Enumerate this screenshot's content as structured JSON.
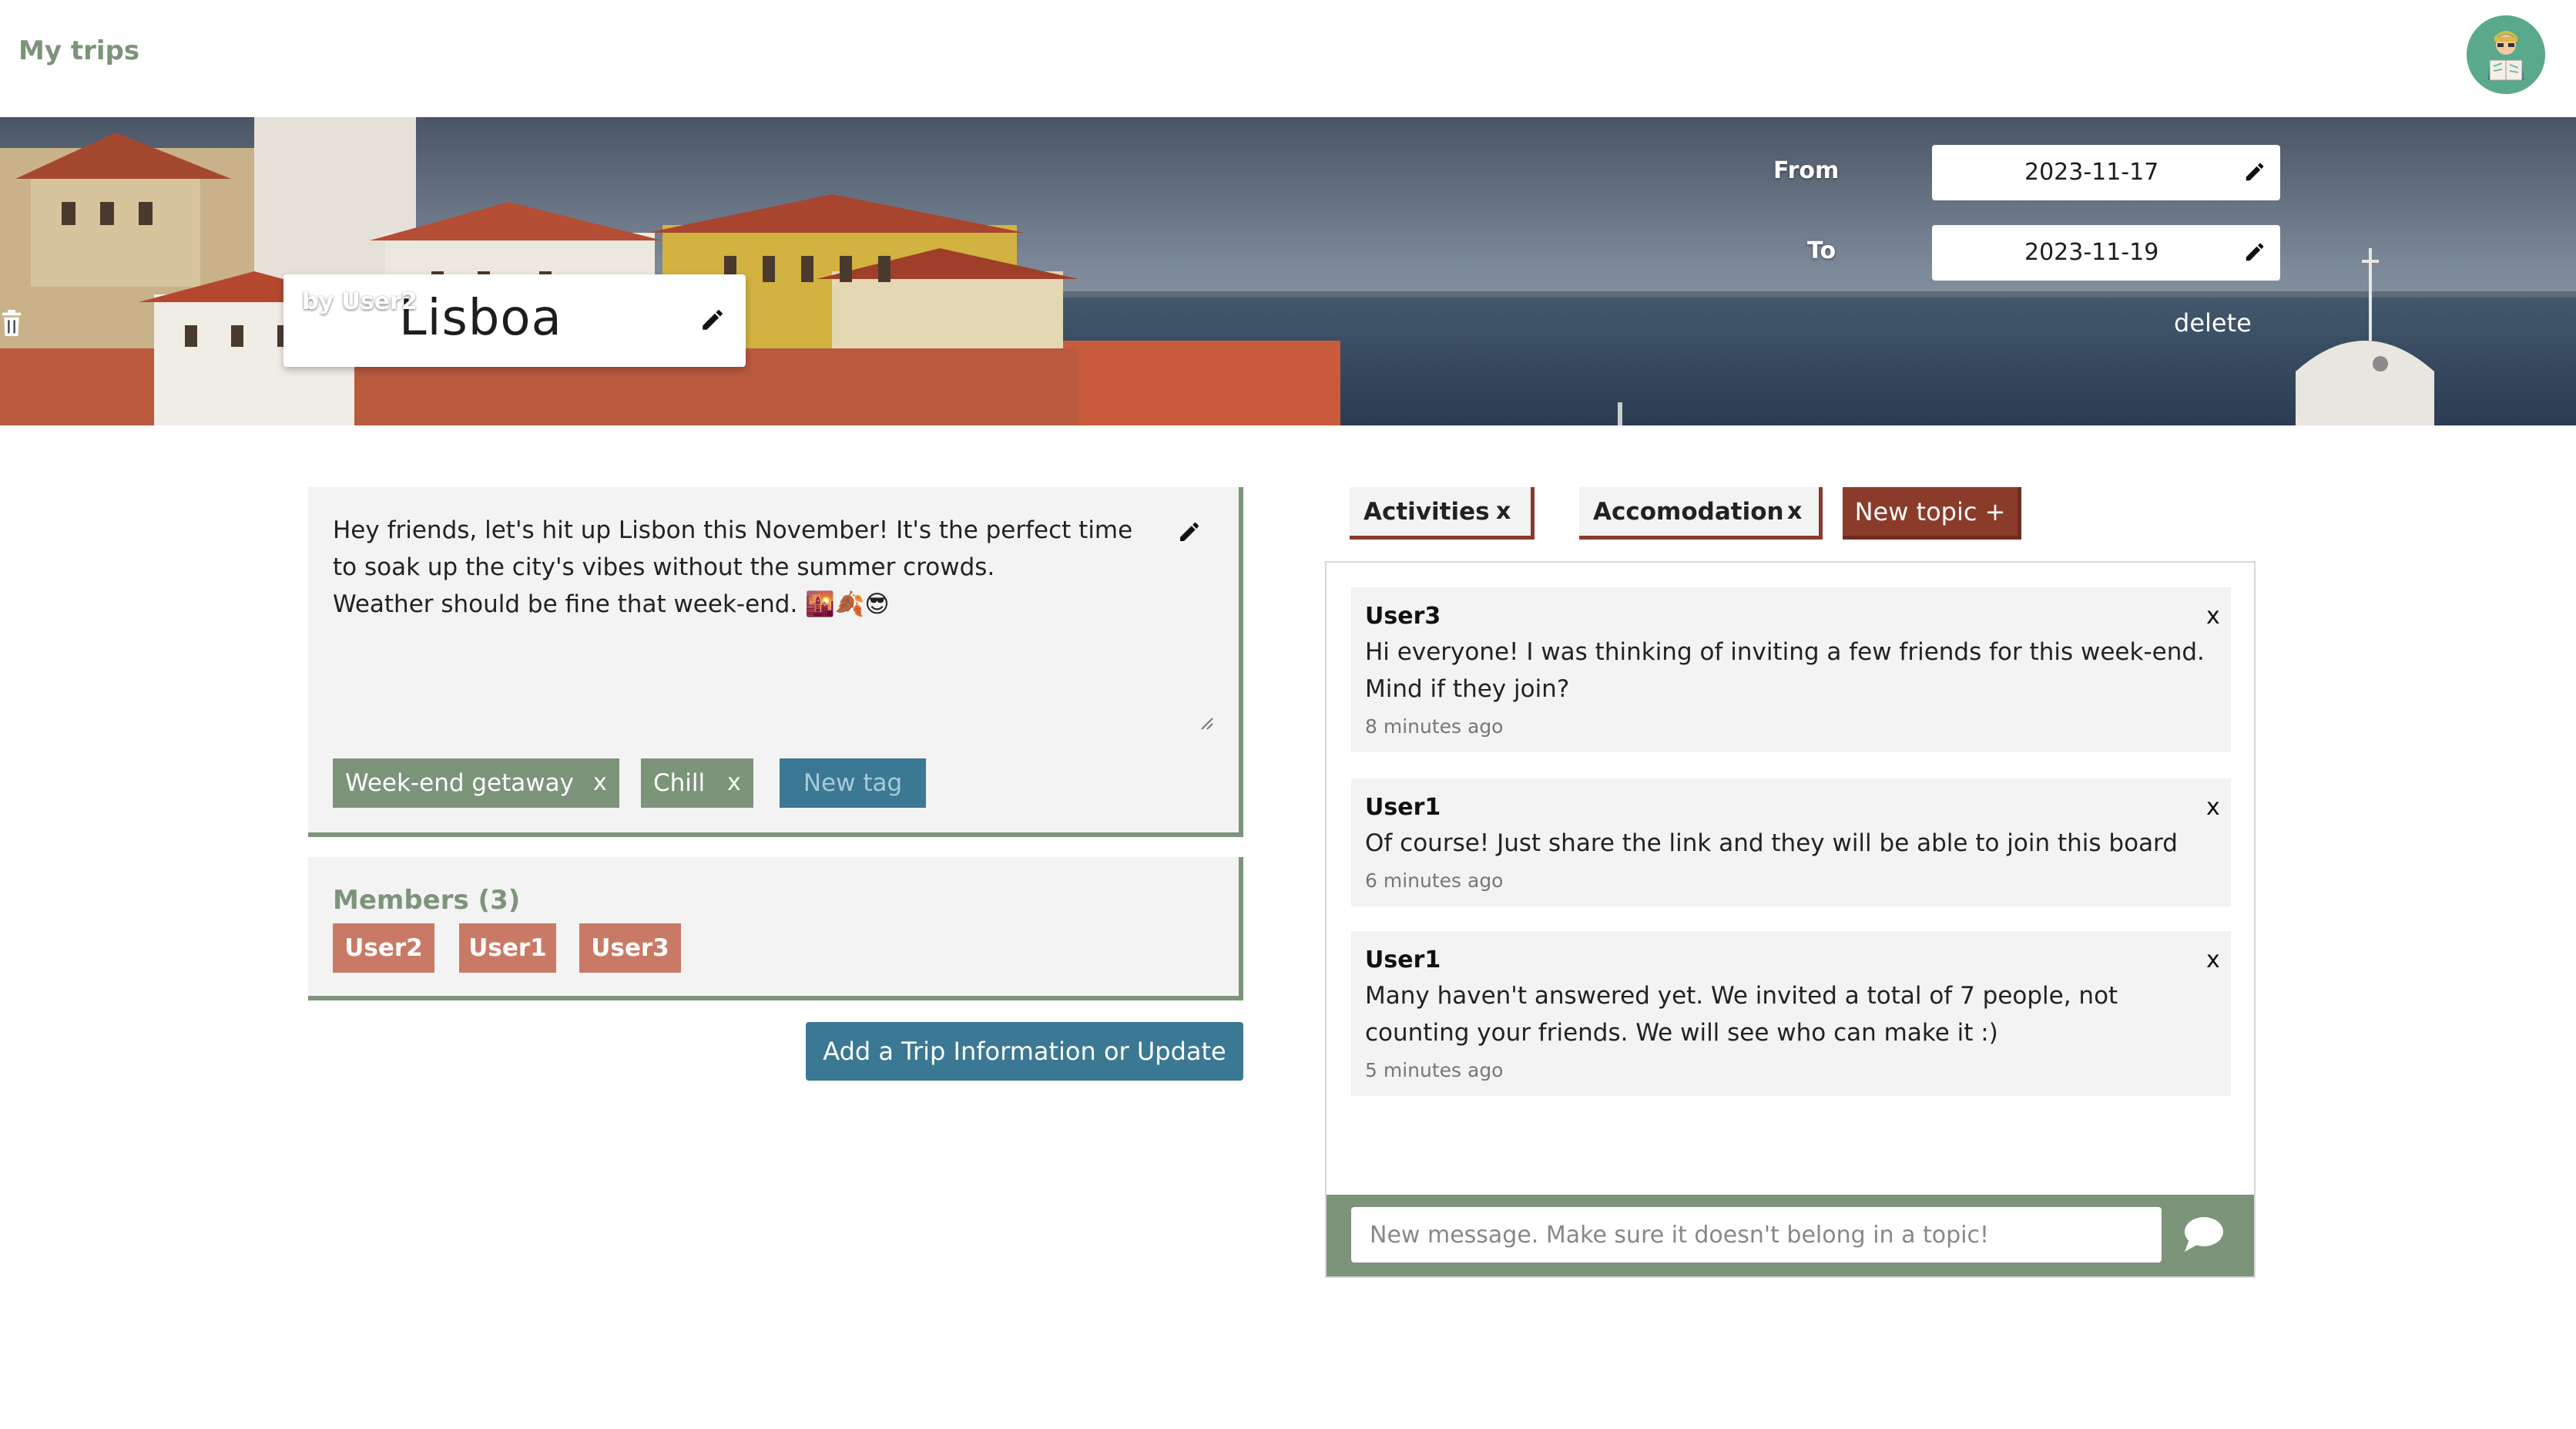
{
  "nav": {
    "title": "My trips",
    "avatar_icon": "traveler-reading-map-avatar"
  },
  "trip": {
    "title": "Lisboa",
    "owner": "by User2",
    "from_label": "From",
    "from_date": "2023-11-17",
    "to_label": "To",
    "to_date": "2023-11-19",
    "delete_label": "delete"
  },
  "description": {
    "lines": [
      "Hey friends, let's hit up Lisbon this November! It's the perfect time",
      "to soak up the city's vibes without the summer crowds.",
      "Weather should be fine that week-end. 🌇🍂😎"
    ]
  },
  "tags": [
    {
      "label": "Week-end getaway",
      "remove": "x"
    },
    {
      "label": "Chill",
      "remove": "x"
    }
  ],
  "new_tag_label": "New tag",
  "members": {
    "title": "Members (3)",
    "list": [
      "User2",
      "User1",
      "User3"
    ]
  },
  "add_update_label": "Add a Trip Information or Update",
  "topics": [
    {
      "label": "Activities",
      "remove": "x"
    },
    {
      "label": "Accomodation",
      "remove": "x"
    }
  ],
  "new_topic_label": "New topic +",
  "messages": [
    {
      "user": "User3",
      "lines": [
        "Hi everyone! I was thinking of inviting a few friends for this week-end.",
        "Mind if they join?"
      ],
      "time": "8 minutes ago",
      "remove": "x"
    },
    {
      "user": "User1",
      "lines": [
        "Of course! Just share the link and they will be able to join this board"
      ],
      "time": "6 minutes ago",
      "remove": "x"
    },
    {
      "user": "User1",
      "lines": [
        "Many haven't answered yet. We invited a total of 7 people, not",
        "counting your friends. We will see who can make it :)"
      ],
      "time": "5 minutes ago",
      "remove": "x"
    }
  ],
  "chat": {
    "placeholder": "New message. Make sure it doesn't belong in a topic!",
    "send_icon": "speech-bubble-icon"
  },
  "colors": {
    "sage": "#7c9479",
    "teal": "#3b7893",
    "terracotta": "#c97a66",
    "brick": "#8a3b2a"
  }
}
